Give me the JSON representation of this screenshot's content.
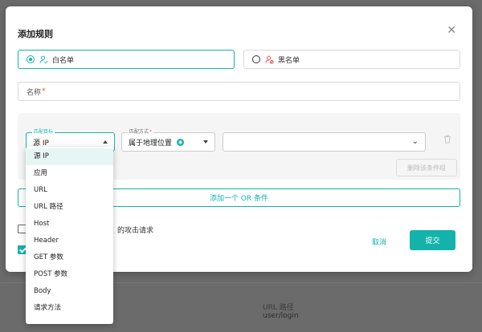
{
  "background": {
    "partial_text": "的攻击请求",
    "row_label": "URL 路径",
    "row_value": "user/login"
  },
  "modal": {
    "title": "添加规则",
    "close_icon": "close-icon",
    "whitelist_label": "白名单",
    "blacklist_label": "黑名单",
    "name_placeholder": "名称",
    "required_mark": "*",
    "condition": {
      "target_label": "匹配目标",
      "target_value": "源 IP",
      "method_label": "匹配方式",
      "method_value": "属于地理位置",
      "value_placeholder": ""
    },
    "delete_group_label": "删除该条件组",
    "add_or_label": "添加一个 OR 条件",
    "attack_request_label": "的攻击请求",
    "cancel_label": "取消",
    "submit_label": "提交"
  },
  "dropdown": {
    "selected": "源 IP",
    "options": [
      "源 IP",
      "应用",
      "URL",
      "URL 路径",
      "Host",
      "Header",
      "GET 参数",
      "POST 参数",
      "Body",
      "请求方法"
    ]
  },
  "colors": {
    "accent": "#13b3ab",
    "required": "#e84a4a"
  }
}
